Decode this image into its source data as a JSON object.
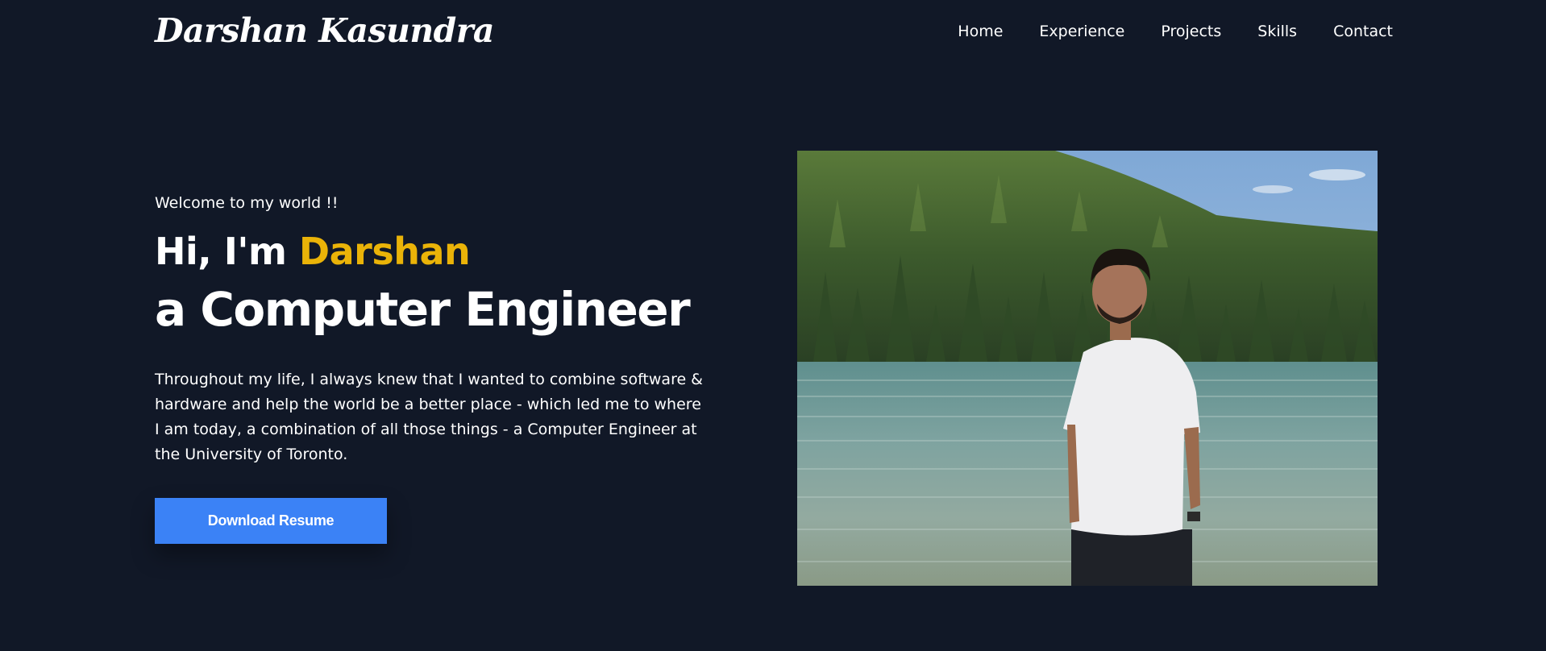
{
  "header": {
    "brand": "Darshan Kasundra",
    "nav": [
      "Home",
      "Experience",
      "Projects",
      "Skills",
      "Contact"
    ]
  },
  "hero": {
    "welcome": "Welcome to my world !!",
    "greeting_prefix": "Hi, I'm ",
    "greeting_name": "Darshan",
    "role": "a Computer Engineer",
    "bio_lines": [
      "Throughout my life, I always knew that I wanted to combine software &",
      "hardware and help the world be a better place - which led me to where",
      "I am today, a combination of all those things - a Computer Engineer at",
      "the University of Toronto."
    ],
    "button": "Download Resume"
  },
  "colors": {
    "background": "#111827",
    "accent": "#eab308",
    "button": "#3b82f6",
    "text": "#ffffff"
  }
}
